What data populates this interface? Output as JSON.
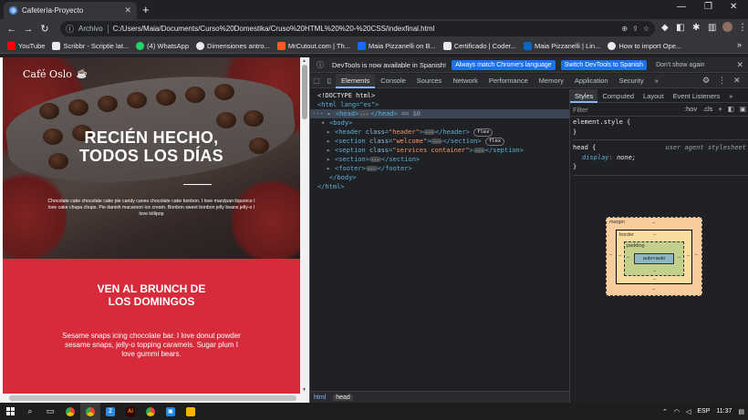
{
  "browser": {
    "tab_title": "Cafetería-Proyecto",
    "scheme": "Archivo",
    "url": "C:/Users/Maia/Documents/Curso%20Domestika/Cruso%20HTML%20%20-%20CSS/indexfinal.html",
    "new_tab_label": "+",
    "bookmarks": [
      {
        "label": "YouTube",
        "color": "#ff0000"
      },
      {
        "label": "Scribbr - Scriptie lat...",
        "color": "#e8eaed"
      },
      {
        "label": "(4) WhatsApp",
        "color": "#25d366"
      },
      {
        "label": "Dimensiones antro...",
        "color": "#e8eaed"
      },
      {
        "label": "MrCutout.com | Th...",
        "color": "#ff5a1f"
      },
      {
        "label": "Maia Pizzanelli on B...",
        "color": "#1769ff"
      },
      {
        "label": "Certificado | Coder...",
        "color": "#e8eaed"
      },
      {
        "label": "Maia Pizzanelli | Lin...",
        "color": "#0a66c2"
      },
      {
        "label": "How to import Ope...",
        "color": "#e8eaed"
      }
    ]
  },
  "site": {
    "brand": "Café Oslo",
    "hero_title_1": "RECIÉN HECHO,",
    "hero_title_2": "TODOS LOS DÍAS",
    "hero_text": "Chocolate cake chocolate cake pie candy canes chocolate cake bonbon. I love marzipan liquorice I love cake chupa chups. Pie danish macaroon ice cream. Bonbon sweet bonbon jelly beans jelly-o I love lollipop",
    "welcome_title_1": "VEN AL BRUNCH DE",
    "welcome_title_2": "LOS DOMINGOS",
    "welcome_text": "Sesame snaps icing chocolate bar. I love donut powder sesame snaps, jelly-o topping caramels. Sugar plum I love gummi bears."
  },
  "devtools": {
    "notice": "DevTools is now available in Spanish!",
    "btn_match": "Always match Chrome's language",
    "btn_switch": "Switch DevTools to Spanish",
    "btn_dont": "Don't show again",
    "tabs": [
      "Elements",
      "Console",
      "Sources",
      "Network",
      "Performance",
      "Memory",
      "Application",
      "Security"
    ],
    "dom": {
      "doctype": "<!DOCTYPE html>",
      "html_open": "<html lang=\"es\">",
      "head": "<head>",
      "head_close": "</head>",
      "eq": "== $0",
      "body": "<body>",
      "header_tag": "header",
      "header_class": "\"header\"",
      "welcome_class": "\"welcome\"",
      "services_class": "\"services container\"",
      "section": "section",
      "footer": "footer",
      "body_close": "</body>",
      "html_close": "</html>",
      "flex": "flex",
      "ellipsis": "...",
      "class_attr": "class",
      "seption": "seption"
    },
    "crumbs": [
      "html",
      "head"
    ],
    "style_tabs": [
      "Styles",
      "Computed",
      "Layout",
      "Event Listeners"
    ],
    "filter": "Filter",
    "hov": ":hov",
    "cls": ".cls",
    "rules": {
      "element_style": "element.style {",
      "close": "}",
      "selector": "head {",
      "source": "user agent stylesheet",
      "prop": "display",
      "val": "none;"
    },
    "boxmodel": {
      "margin": "margin",
      "border": "border",
      "padding": "padding",
      "dash": "–",
      "content": "auto×auto"
    }
  },
  "taskbar": {
    "lang": "ESP",
    "time": "11:37"
  }
}
